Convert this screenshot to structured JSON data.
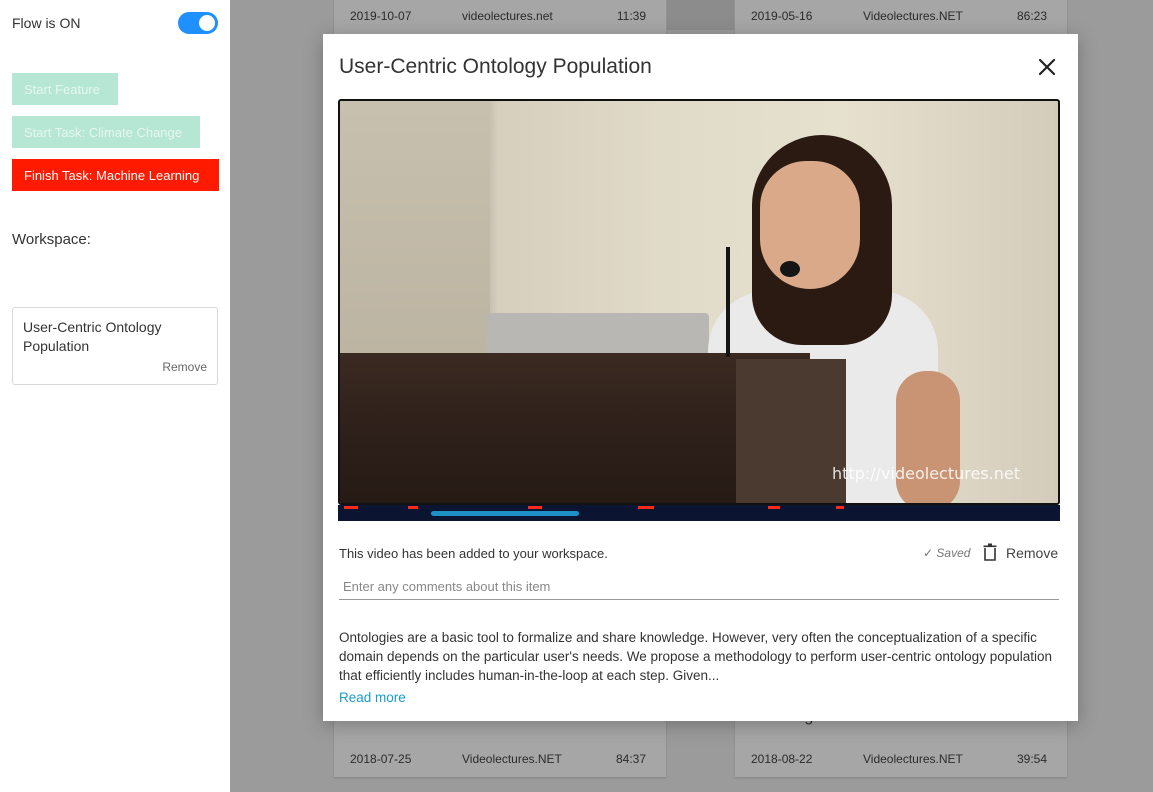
{
  "sidebar": {
    "flow_label": "Flow is ON",
    "flow_toggle_on": true,
    "start_feature_label": "Start Feature",
    "start_task_label": "Start Task: Climate Change",
    "finish_task_label": "Finish Task: Machine Learning",
    "workspace_label": "Workspace:",
    "workspace_items": [
      {
        "title": "User-Centric Ontology Population",
        "remove_label": "Remove"
      }
    ]
  },
  "background_cards": [
    {
      "date": "2019-10-07",
      "source": "videolectures.net",
      "duration": "11:39"
    },
    {
      "date": "2019-05-16",
      "source": "Videolectures.NET",
      "duration": "86:23"
    },
    {
      "date": "2018-07-25",
      "source": "Videolectures.NET",
      "duration": "84:37",
      "title": ""
    },
    {
      "date": "2018-08-22",
      "source": "Videolectures.NET",
      "duration": "39:54",
      "title": "Learning"
    }
  ],
  "modal": {
    "title": "User-Centric Ontology Population",
    "video_watermark": "http://videolectures.net",
    "added_message": "This video has been added to your workspace.",
    "saved_label": "✓ Saved",
    "remove_label": "Remove",
    "comment_placeholder": "Enter any comments about this item",
    "abstract": "Ontologies are a basic tool to formalize and share knowledge. However, very often the conceptualization of a specific domain depends on the particular user's needs. We propose a methodology to perform user-centric ontology population that efficiently includes human-in-the-loop at each step. Given...",
    "read_more_label": "Read more"
  },
  "colors": {
    "accent": "#1e90ff",
    "finish_button": "#ff1a00",
    "faded_button": "#b6e6d4",
    "link": "#1a9bc8"
  }
}
